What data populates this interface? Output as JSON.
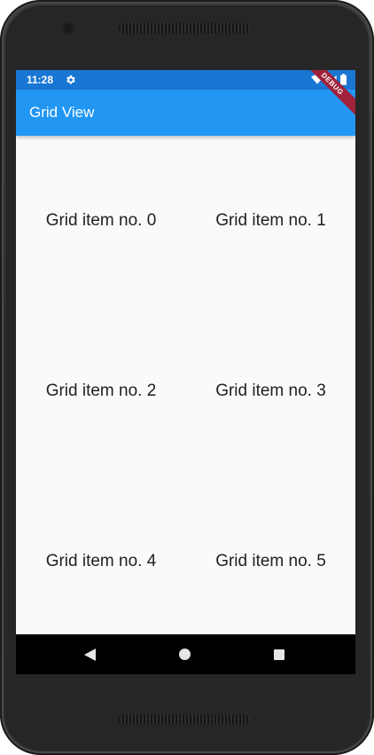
{
  "status_bar": {
    "time": "11:28",
    "settings_icon": "gear-icon",
    "wifi_icon": "wifi-icon",
    "signal_icon": "signal-icon",
    "battery_icon": "battery-icon",
    "color": "#1976d2"
  },
  "app_bar": {
    "title": "Grid View",
    "color": "#2196f3"
  },
  "debug_banner": {
    "label": "DEBUG",
    "color": "#a0223a"
  },
  "grid": {
    "items": [
      {
        "label": "Grid item no. 0"
      },
      {
        "label": "Grid item no. 1"
      },
      {
        "label": "Grid item no. 2"
      },
      {
        "label": "Grid item no. 3"
      },
      {
        "label": "Grid item no. 4"
      },
      {
        "label": "Grid item no. 5"
      }
    ]
  },
  "nav_bar": {
    "back_icon": "back-triangle-icon",
    "home_icon": "home-circle-icon",
    "recents_icon": "recents-square-icon"
  }
}
